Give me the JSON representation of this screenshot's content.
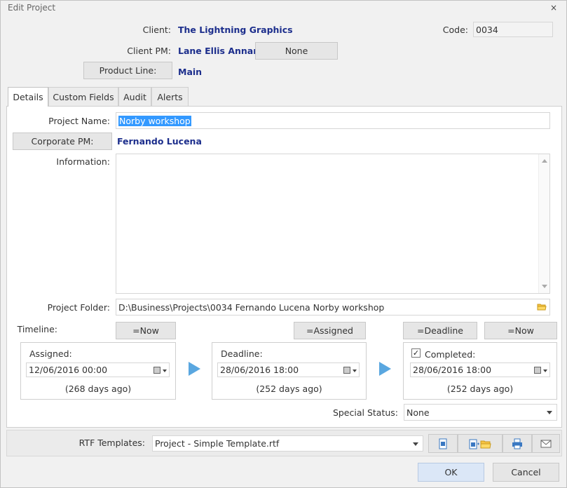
{
  "window": {
    "title": "Edit Project",
    "close_glyph": "×"
  },
  "header": {
    "client_label": "Client:",
    "client_value": "The Lightning Graphics",
    "code_label": "Code:",
    "code_value": "0034",
    "client_pm_label": "Client PM:",
    "client_pm_value": "Lane Ellis Annan",
    "client_pm_button": "None",
    "product_line_button": "Product Line:",
    "product_line_value": "Main"
  },
  "tabs": [
    {
      "label": "Details",
      "active": true
    },
    {
      "label": "Custom Fields",
      "active": false
    },
    {
      "label": "Audit",
      "active": false
    },
    {
      "label": "Alerts",
      "active": false
    }
  ],
  "details": {
    "project_name_label": "Project Name:",
    "project_name_value": "Norby workshop",
    "corporate_pm_button": "Corporate PM:",
    "corporate_pm_value": "Fernando Lucena",
    "information_label": "Information:",
    "information_value": "",
    "project_folder_label": "Project Folder:",
    "project_folder_value": "D:\\Business\\Projects\\0034 Fernando Lucena Norby workshop",
    "timeline_label": "Timeline:",
    "now_button_1": "=Now",
    "assigned_button": "=Assigned",
    "deadline_button": "=Deadline",
    "now_button_2": "=Now",
    "assigned": {
      "label": "Assigned:",
      "value": "12/06/2016 00:00",
      "note": "(268 days ago)"
    },
    "deadline": {
      "label": "Deadline:",
      "value": "28/06/2016 18:00",
      "note": "(252 days ago)"
    },
    "completed": {
      "label": "Completed:",
      "checked": true,
      "check_glyph": "✓",
      "value": "28/06/2016 18:00",
      "note": "(252 days ago)"
    },
    "special_status_label": "Special Status:",
    "special_status_value": "None"
  },
  "rtf": {
    "label": "RTF Templates:",
    "value": "Project - Simple Template.rtf"
  },
  "footer": {
    "ok": "OK",
    "cancel": "Cancel"
  },
  "colors": {
    "accent_value": "#1c2e8c",
    "selection": "#3399ff",
    "arrow": "#5aa7e0"
  }
}
